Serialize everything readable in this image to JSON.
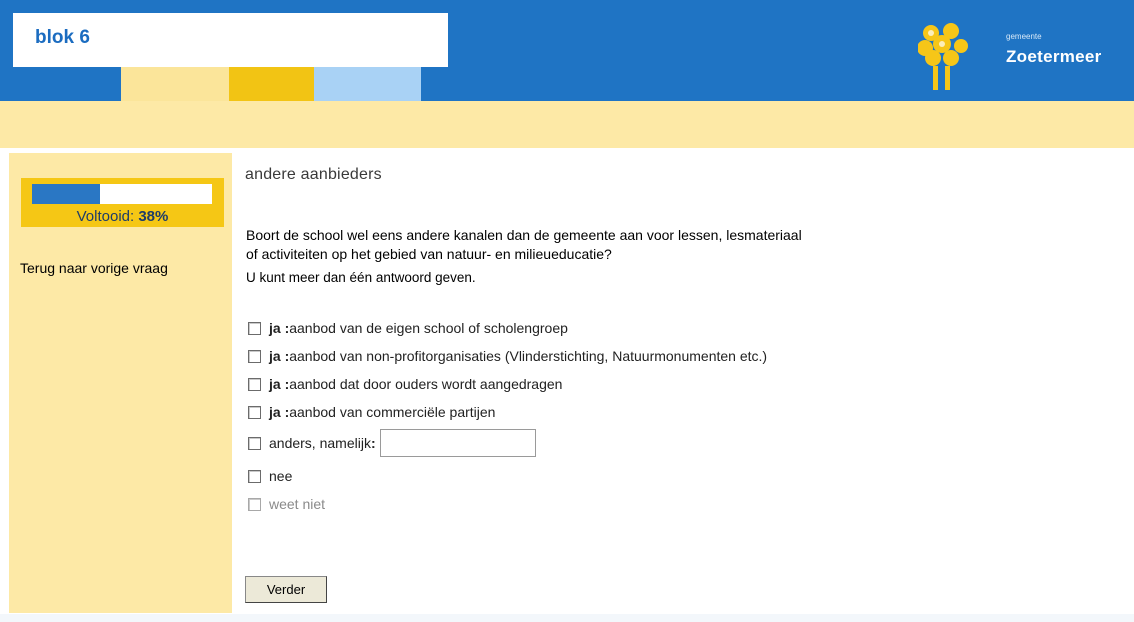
{
  "header": {
    "block_title": "blok 6",
    "logo": {
      "small_text": "gemeente",
      "name": "Zoetermeer",
      "icon": "zoetermeer-tree-logo"
    }
  },
  "colors": {
    "header_blue": "#1f74c4",
    "band_yellow": "#fde9a6",
    "accent_yellow": "#f2c414",
    "light_blue": "#a9d2f5",
    "progress_blue": "#2a77c4"
  },
  "sidebar": {
    "progress_label": "Voltooid:",
    "progress_value": "38%",
    "progress_fraction": 0.38,
    "back_link": "Terug naar vorige vraag"
  },
  "main": {
    "title": "andere aanbieders",
    "question_line1": "Boort de school wel eens andere kanalen dan de gemeente aan voor lessen, lesmateriaal",
    "question_line2": "of activiteiten op het gebied van natuur- en milieueducatie?",
    "hint": "U kunt meer dan één antwoord geven.",
    "options": [
      {
        "prefix": "ja :",
        "label": " aanbod van de eigen school of scholengroep",
        "checked": false
      },
      {
        "prefix": "ja :",
        "label": " aanbod van non-profitorganisaties (Vlinderstichting, Natuurmonumenten etc.)",
        "checked": false
      },
      {
        "prefix": "ja :",
        "label": " aanbod dat door ouders wordt aangedragen",
        "checked": false
      },
      {
        "prefix": "ja :",
        "label": " aanbod van commerciële partijen",
        "checked": false
      },
      {
        "prefix": "",
        "label": "anders, namelijk",
        "suffix": " :",
        "checked": false,
        "input_value": ""
      },
      {
        "prefix": "",
        "label": "nee",
        "checked": false
      },
      {
        "prefix": "",
        "label": "weet niet",
        "checked": false
      }
    ],
    "submit_label": "Verder"
  }
}
